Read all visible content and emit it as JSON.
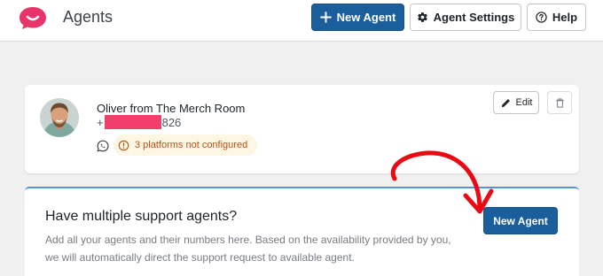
{
  "header": {
    "title": "Agents",
    "new_agent_label": "New Agent",
    "agent_settings_label": "Agent Settings",
    "help_label": "Help"
  },
  "agent": {
    "name": "Oliver from The Merch Room",
    "phone_prefix": "+",
    "phone_suffix": "826",
    "warning": "3 platforms not configured",
    "edit_label": "Edit"
  },
  "promo": {
    "title": "Have multiple support agents?",
    "description": "Add all your agents and their numbers here. Based on the availability provided by you, we will automatically direct the support request to available agent.",
    "button_label": "New Agent"
  },
  "colors": {
    "primary": "#1a5e9b",
    "brand": "#e8336b",
    "redaction": "#ef3f6a",
    "warning_text": "#b6541b",
    "warning_bg": "#fdf6e3",
    "annotation_arrow": "#ea0a13"
  },
  "icons": {
    "logo": "chat-smile-icon",
    "new_agent": "plus-icon",
    "settings": "gear-icon",
    "help": "question-circle-icon",
    "whatsapp": "whatsapp-icon",
    "warning": "info-circle-icon",
    "edit": "pencil-icon",
    "delete": "trash-icon"
  }
}
